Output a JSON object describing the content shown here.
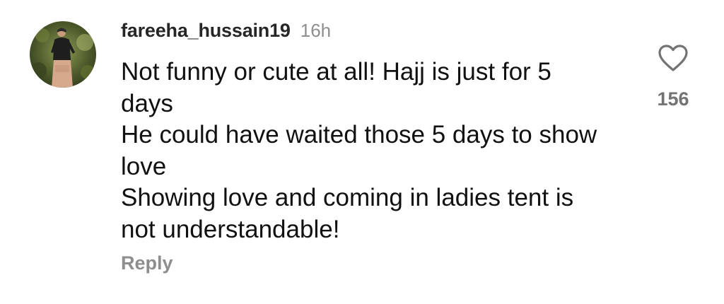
{
  "comment": {
    "username": "fareeha_hussain19",
    "time": "16h",
    "lines": [
      "Not funny or cute at all! Hajj is just for 5",
      "days",
      "He could have waited those 5 days to show",
      "love",
      "Showing love and coming in ladies tent is",
      "not understandable!"
    ],
    "reply_label": "Reply",
    "like_count": "156",
    "like_icon": "heart-outline-icon"
  },
  "colors": {
    "username": "#262626",
    "secondary": "#8e8e8e",
    "text": "#111111",
    "count": "#737373"
  }
}
